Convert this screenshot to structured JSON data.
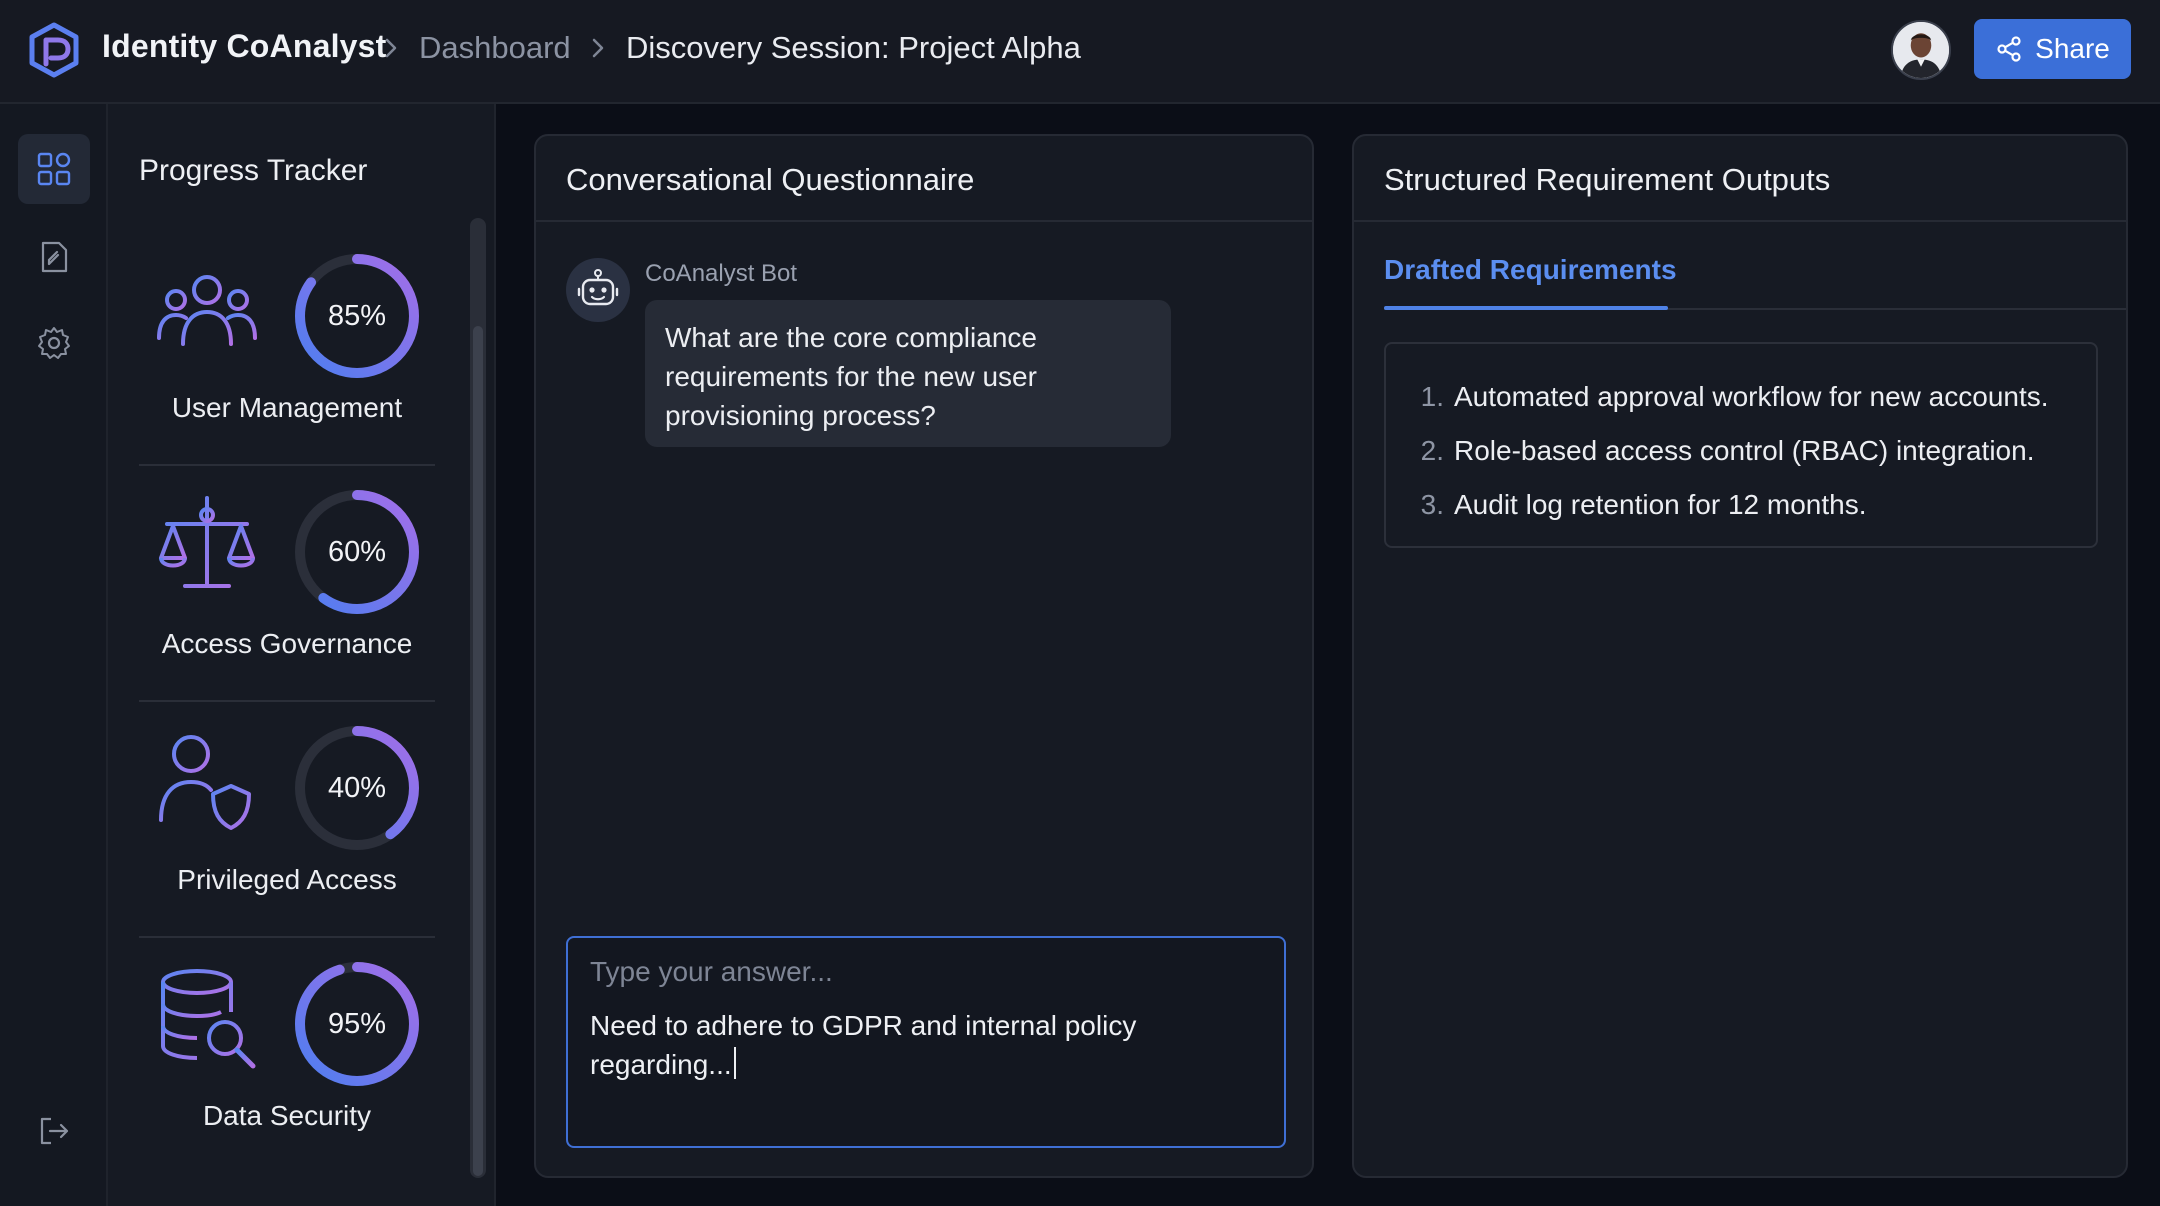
{
  "header": {
    "brand": "Identity CoAnalyst",
    "breadcrumb": {
      "dashboard": "Dashboard",
      "current": "Discovery Session: Project Alpha"
    },
    "share_label": "Share",
    "accent_color": "#3b6fd8"
  },
  "rail": {
    "items": [
      {
        "icon": "dashboard-grid-icon",
        "active": true
      },
      {
        "icon": "document-edit-icon",
        "active": false
      },
      {
        "icon": "gear-icon",
        "active": false
      },
      {
        "icon": "logout-icon",
        "active": false
      }
    ]
  },
  "tracker": {
    "title": "Progress Tracker",
    "items": [
      {
        "label": "User Management",
        "percent_text": "85%",
        "percent": 85,
        "icon": "users-group-icon"
      },
      {
        "label": "Access Governance",
        "percent_text": "60%",
        "percent": 60,
        "icon": "scales-icon"
      },
      {
        "label": "Privileged Access",
        "percent_text": "40%",
        "percent": 40,
        "icon": "user-shield-icon"
      },
      {
        "label": "Data Security",
        "percent_text": "95%",
        "percent": 95,
        "icon": "database-search-icon"
      }
    ],
    "ring_colors": {
      "start": "#4d7ef0",
      "end": "#a46ee8",
      "track": "#2b2f3a"
    }
  },
  "questionnaire": {
    "title": "Conversational Questionnaire",
    "bot_name": "CoAnalyst Bot",
    "bot_message": "What are the core compliance requirements for the new user provisioning process?",
    "input_placeholder": "Type your answer...",
    "input_value": "Need to adhere to GDPR and internal policy regarding..."
  },
  "outputs": {
    "title": "Structured Requirement Outputs",
    "tab_label": "Drafted Requirements",
    "requirements": [
      {
        "num": "1.",
        "text": "Automated approval workflow for new accounts."
      },
      {
        "num": "2.",
        "text": "Role-based access control (RBAC) integration."
      },
      {
        "num": "3.",
        "text": "Audit log retention for 12 months."
      }
    ]
  }
}
